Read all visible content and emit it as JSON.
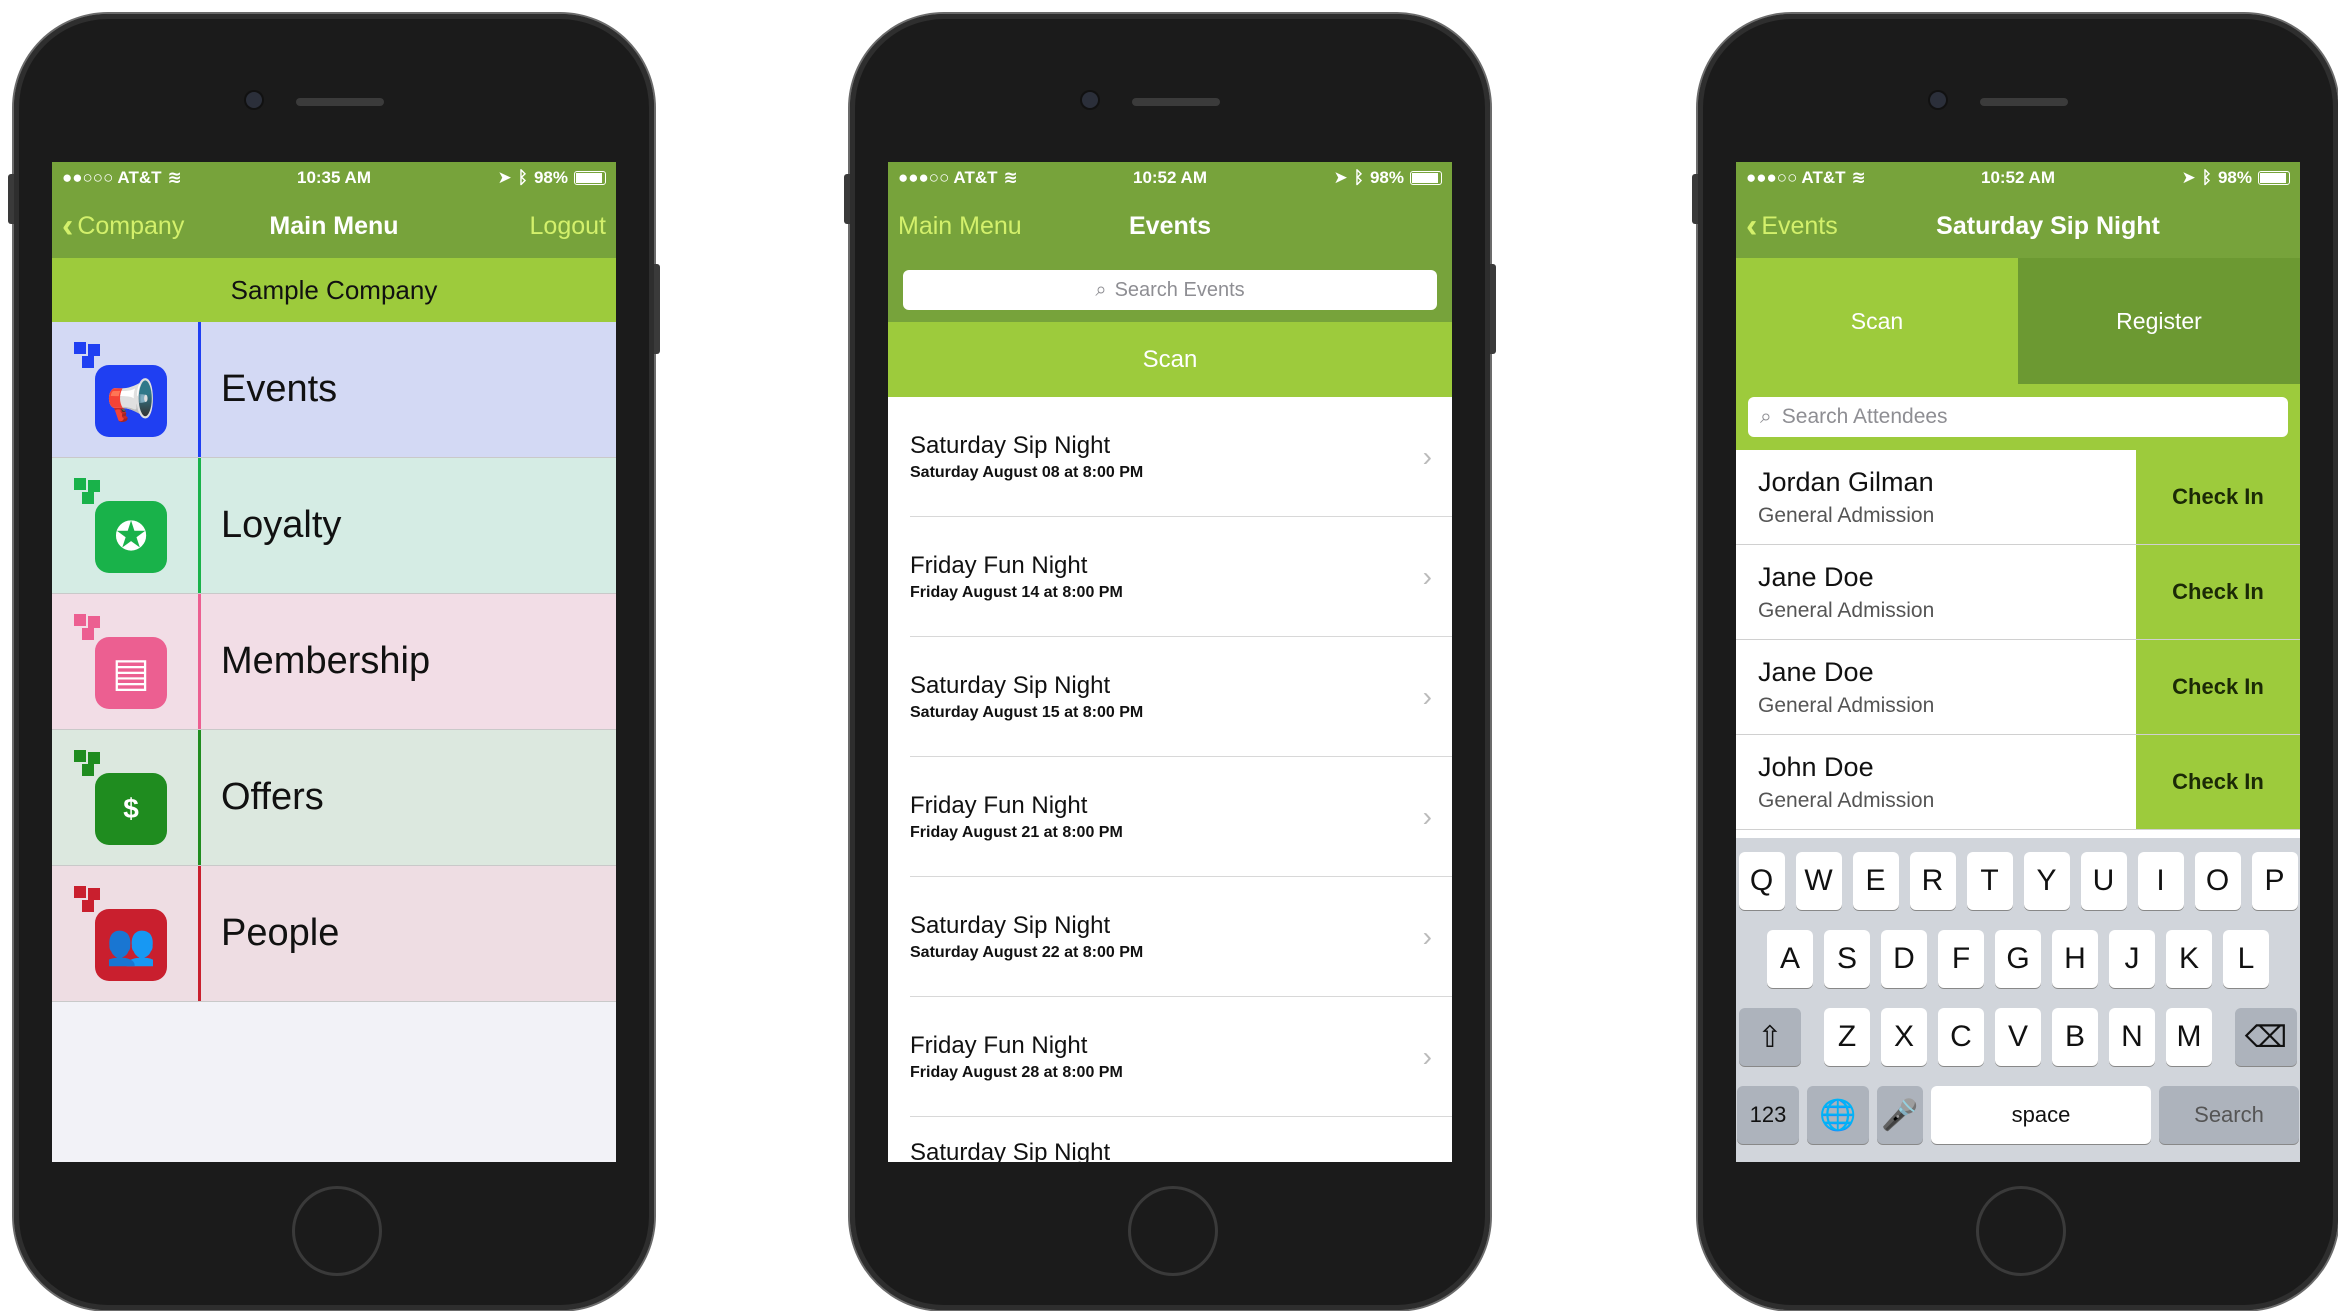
{
  "colors": {
    "nav_green": "#77a33b",
    "accent_green": "#9dcb3c",
    "link_lime": "#d3f06b"
  },
  "phone1": {
    "status": {
      "carrier": "●●○○○ AT&T",
      "time": "10:35 AM",
      "battery": "98%"
    },
    "nav": {
      "back": "Company",
      "title": "Main Menu",
      "right": "Logout"
    },
    "company": "Sample Company",
    "menu": [
      {
        "label": "Events",
        "icon": "megaphone-icon",
        "color": "#1f3ff2",
        "bg": "#d3d9f4"
      },
      {
        "label": "Loyalty",
        "icon": "medal-icon",
        "color": "#19b24a",
        "bg": "#d5ece4"
      },
      {
        "label": "Membership",
        "icon": "id-card-icon",
        "color": "#ec5f91",
        "bg": "#f2dde6"
      },
      {
        "label": "Offers",
        "icon": "coupon-icon",
        "color": "#1f8c1f",
        "bg": "#dce8df"
      },
      {
        "label": "People",
        "icon": "people-icon",
        "color": "#c91f2e",
        "bg": "#eedde3"
      }
    ]
  },
  "phone2": {
    "status": {
      "carrier": "●●●○○ AT&T",
      "time": "10:52 AM",
      "battery": "98%"
    },
    "nav": {
      "back": "Main Menu",
      "title": "Events"
    },
    "search_placeholder": "Search Events",
    "scan": "Scan",
    "events": [
      {
        "title": "Saturday Sip Night",
        "date": "Saturday August 08 at 8:00 PM"
      },
      {
        "title": "Friday Fun Night",
        "date": "Friday August 14 at 8:00 PM"
      },
      {
        "title": "Saturday Sip Night",
        "date": "Saturday August 15 at 8:00 PM"
      },
      {
        "title": "Friday Fun Night",
        "date": "Friday August 21 at 8:00 PM"
      },
      {
        "title": "Saturday Sip Night",
        "date": "Saturday August 22 at 8:00 PM"
      },
      {
        "title": "Friday Fun Night",
        "date": "Friday August 28 at 8:00 PM"
      },
      {
        "title": "Saturday Sip Night",
        "date": ""
      }
    ]
  },
  "phone3": {
    "status": {
      "carrier": "●●●○○ AT&T",
      "time": "10:52 AM",
      "battery": "98%"
    },
    "nav": {
      "back": "Events",
      "title": "Saturday Sip Night"
    },
    "tabs": {
      "scan": "Scan",
      "register": "Register"
    },
    "search_placeholder": "Search Attendees",
    "attendees": [
      {
        "name": "Jordan Gilman",
        "type": "General Admission",
        "action": "Check In"
      },
      {
        "name": "Jane Doe",
        "type": "General Admission",
        "action": "Check In"
      },
      {
        "name": "Jane Doe",
        "type": "General Admission",
        "action": "Check In"
      },
      {
        "name": "John Doe",
        "type": "General Admission",
        "action": "Check In"
      }
    ],
    "keyboard": {
      "row1": [
        "Q",
        "W",
        "E",
        "R",
        "T",
        "Y",
        "U",
        "I",
        "O",
        "P"
      ],
      "row2": [
        "A",
        "S",
        "D",
        "F",
        "G",
        "H",
        "J",
        "K",
        "L"
      ],
      "row3": [
        "Z",
        "X",
        "C",
        "V",
        "B",
        "N",
        "M"
      ],
      "numbers": "123",
      "space": "space",
      "search": "Search"
    }
  }
}
